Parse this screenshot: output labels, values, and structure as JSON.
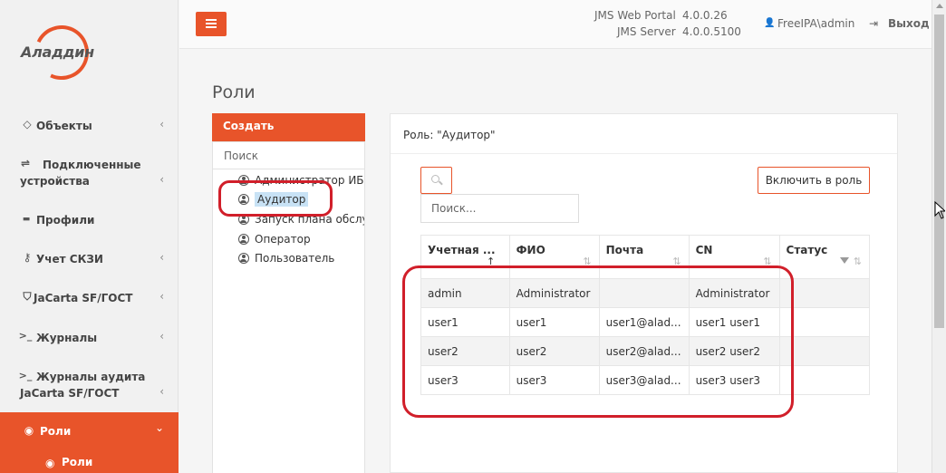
{
  "brand": {
    "logo_text": "Аладдин"
  },
  "sidebar": {
    "items": [
      {
        "icon": "diamond-icon",
        "glyph": "◇",
        "label": "Объекты",
        "chevron": "‹"
      },
      {
        "icon": "usb-icon",
        "glyph": "⇌",
        "label_line1": "Подключенные",
        "label_line2": "устройства",
        "chevron": "‹"
      },
      {
        "icon": "folder-icon",
        "glyph": "▬",
        "label": "Профили"
      },
      {
        "icon": "key-icon",
        "glyph": "⚷",
        "label": "Учет СКЗИ",
        "chevron": "‹"
      },
      {
        "icon": "shield-icon",
        "glyph": "⛉",
        "label": "JaCarta SF/ГОСТ",
        "chevron": "‹"
      },
      {
        "icon": "terminal-icon",
        "glyph": ">_",
        "label": "Журналы",
        "chevron": "‹"
      },
      {
        "icon": "terminal-icon",
        "glyph": ">_",
        "label_line1": "Журналы аудита",
        "label_line2": "JaCarta SF/ГОСТ",
        "chevron": "‹"
      },
      {
        "icon": "user-circle-icon",
        "glyph": "◉",
        "label": "Роли",
        "chevron": "⌄",
        "active": true
      }
    ],
    "sub_item": {
      "icon": "user-circle-icon",
      "glyph": "◉",
      "label": "Роли"
    }
  },
  "header": {
    "portal_label": "JMS Web Portal",
    "portal_version": "4.0.0.26",
    "server_label": "JMS Server",
    "server_version": "4.0.0.5100",
    "user": "FreeIPA\\admin",
    "user_glyph": "👤",
    "logout": "Выход",
    "logout_glyph": "⇥"
  },
  "page": {
    "title": "Роли"
  },
  "roles_panel": {
    "create_label": "Создать",
    "search_placeholder": "Поиск",
    "roles": [
      {
        "label": "Администратор ИБ"
      },
      {
        "label": "Аудитор",
        "selected": true
      },
      {
        "label": "Запуск плана обслуживания"
      },
      {
        "label": "Оператор"
      },
      {
        "label": "Пользователь"
      }
    ]
  },
  "role_detail": {
    "header": "Роль: \"Аудитор\"",
    "include_button": "Включить в роль",
    "search_placeholder": "Поиск...",
    "columns": [
      {
        "label": "Учетная ...",
        "sort": "↑"
      },
      {
        "label": "ФИО",
        "sort": "⇅"
      },
      {
        "label": "Почта",
        "sort": "⇅"
      },
      {
        "label": "CN",
        "sort": "⇅"
      },
      {
        "label": "Статус",
        "sort": "⇅"
      }
    ],
    "rows": [
      {
        "account": "admin",
        "fio": "Administrator",
        "mail": "",
        "cn": "Administrator",
        "status": ""
      },
      {
        "account": "user1",
        "fio": "user1",
        "mail": "user1@alad...",
        "cn": "user1 user1",
        "status": ""
      },
      {
        "account": "user2",
        "fio": "user2",
        "mail": "user2@alad...",
        "cn": "user2 user2",
        "status": ""
      },
      {
        "account": "user3",
        "fio": "user3",
        "mail": "user3@alad...",
        "cn": "user3 user3",
        "status": ""
      }
    ]
  },
  "colors": {
    "accent": "#e8542a",
    "highlight": "#d11f2a",
    "selection": "#c8e2f5"
  }
}
